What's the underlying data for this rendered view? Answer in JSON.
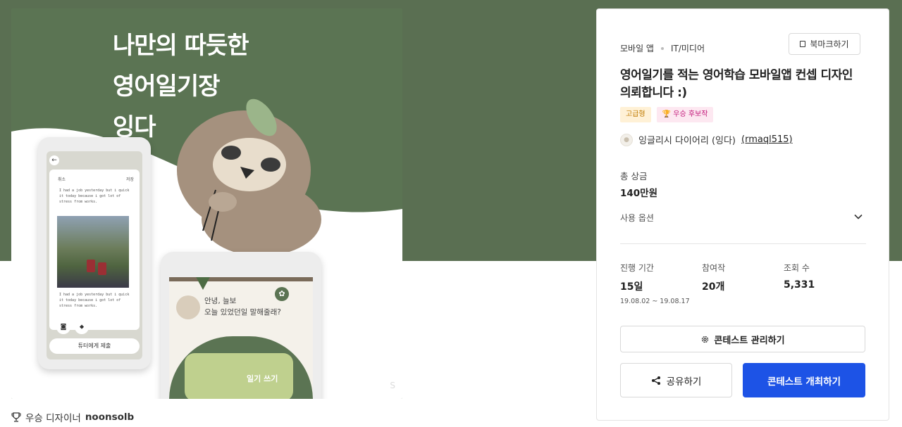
{
  "hero": {
    "title_lines": [
      "나만의 따듯한",
      "영어일기장",
      "잉다"
    ],
    "phone1": {
      "cancel": "취소",
      "save": "저장",
      "diary_text_1": "I had a job yesterday but i quick it today because i got lot of stress from works.",
      "diary_text_2": "I had a job yesterday but i quick it today because i got lot of stress from works.",
      "submit_button": "튜터에게 제출"
    },
    "phone2": {
      "greeting_line1": "안녕, 늘보",
      "greeting_line2": "오늘 있었던일 말해줄래?",
      "write_button": "일기 쓰기"
    },
    "watermark": "S"
  },
  "winner": {
    "label": "우승 디자이너",
    "name": "noonsolb"
  },
  "panel": {
    "category_1": "모바일 앱",
    "category_2": "IT/미디어",
    "bookmark_label": "북마크하기",
    "title": "영어일기를 적는 영어학습 모바일앱 컨셉 디자인 의뢰합니다 :)",
    "badge_premium": "고급형",
    "badge_candidate": "우승 후보작",
    "host_name": "잉글리시 다이어리 (잉다)",
    "host_id": "(rmaql515)",
    "prize_label": "총 상금",
    "prize_value": "140만원",
    "usage_label": "사용 옵션",
    "stats": [
      {
        "label": "진행 기간",
        "value": "15일",
        "sub": "19.08.02 ~ 19.08.17"
      },
      {
        "label": "참여작",
        "value": "20개",
        "sub": ""
      },
      {
        "label": "조회 수",
        "value": "5,331",
        "sub": ""
      }
    ],
    "manage_button": "콘테스트 관리하기",
    "share_button": "공유하기",
    "host_button": "콘테스트 개최하기"
  },
  "colors": {
    "band_green": "#5a6f52",
    "primary_blue": "#1d53e6",
    "badge_gold": "#c07b00",
    "badge_pink": "#c2187a"
  },
  "icons": [
    "trophy-icon",
    "bookmark-icon",
    "chevron-down-icon",
    "gear-icon",
    "share-icon",
    "camera-icon",
    "location-icon",
    "back-arrow-icon"
  ]
}
